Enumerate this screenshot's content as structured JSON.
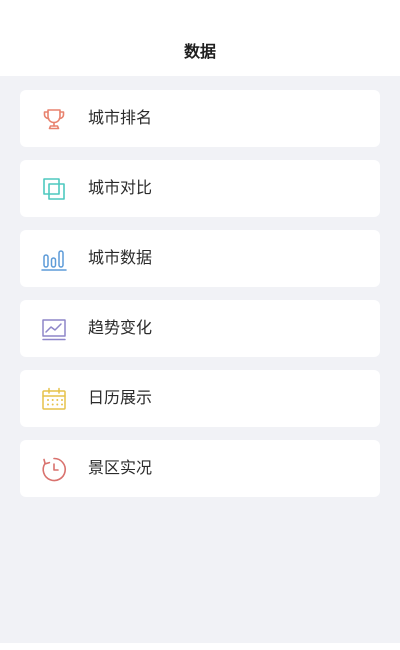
{
  "header": {
    "title": "数据"
  },
  "menu": {
    "items": [
      {
        "label": "城市排名",
        "icon": "trophy-icon",
        "color": "#e8826e"
      },
      {
        "label": "城市对比",
        "icon": "compare-icon",
        "color": "#4ec9bf"
      },
      {
        "label": "城市数据",
        "icon": "bar-chart-icon",
        "color": "#5d9bd8"
      },
      {
        "label": "趋势变化",
        "icon": "trend-icon",
        "color": "#8e86c9"
      },
      {
        "label": "日历展示",
        "icon": "calendar-icon",
        "color": "#e6c24a"
      },
      {
        "label": "景区实况",
        "icon": "timer-icon",
        "color": "#d9726e"
      }
    ]
  }
}
